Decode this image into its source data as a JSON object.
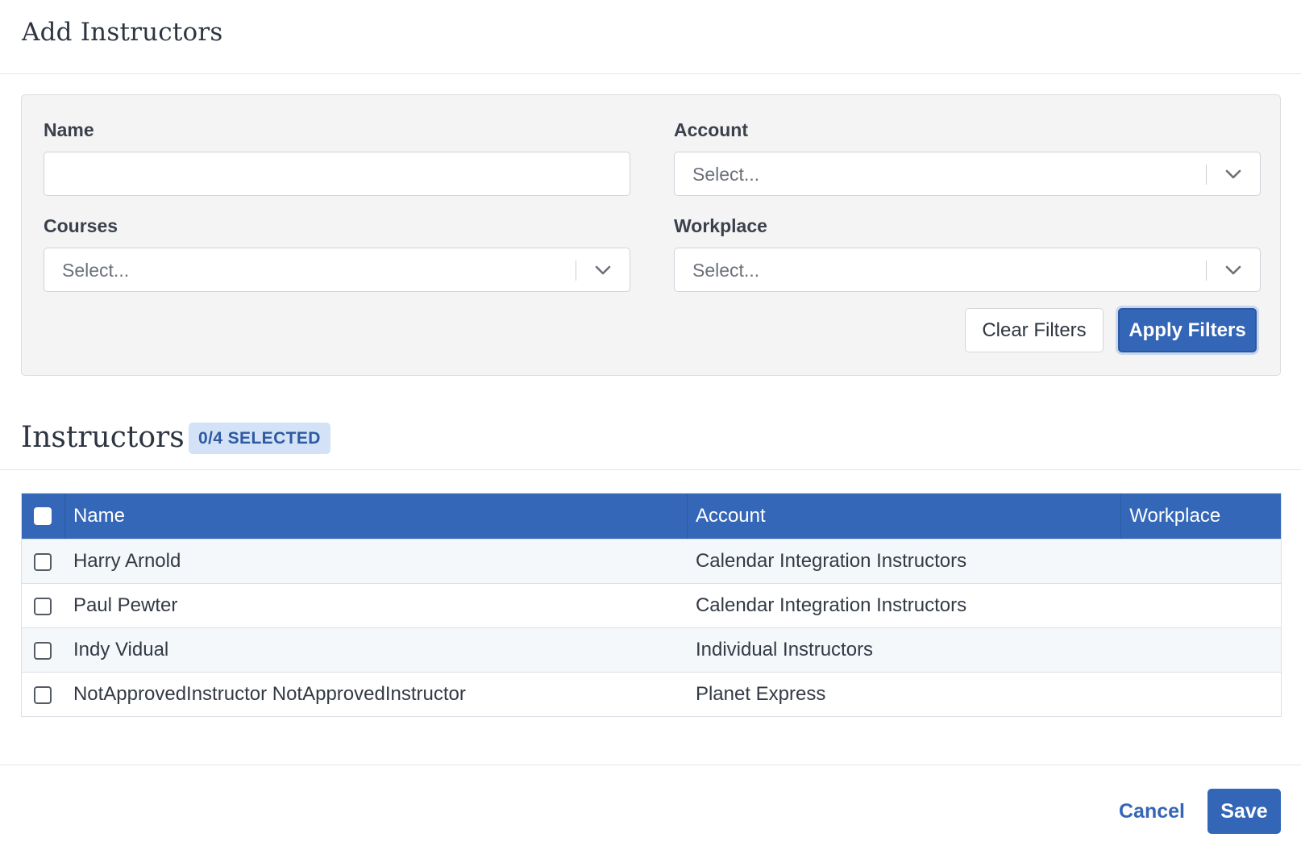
{
  "modal": {
    "title": "Add Instructors"
  },
  "filters": {
    "name": {
      "label": "Name",
      "value": "",
      "placeholder": ""
    },
    "account": {
      "label": "Account",
      "placeholder": "Select..."
    },
    "courses": {
      "label": "Courses",
      "placeholder": "Select..."
    },
    "workplace": {
      "label": "Workplace",
      "placeholder": "Select..."
    },
    "clear_label": "Clear Filters",
    "apply_label": "Apply Filters"
  },
  "instructors": {
    "title": "Instructors",
    "selected_badge": "0/4 SELECTED",
    "columns": [
      "Name",
      "Account",
      "Workplace"
    ],
    "rows": [
      {
        "name": "Harry Arnold",
        "account": "Calendar Integration Instructors",
        "workplace": "",
        "checked": false
      },
      {
        "name": "Paul Pewter",
        "account": "Calendar Integration Instructors",
        "workplace": "",
        "checked": false
      },
      {
        "name": "Indy Vidual",
        "account": "Individual Instructors",
        "workplace": "",
        "checked": false
      },
      {
        "name": "NotApprovedInstructor NotApprovedInstructor",
        "account": "Planet Express",
        "workplace": "",
        "checked": false
      }
    ]
  },
  "footer": {
    "cancel_label": "Cancel",
    "save_label": "Save"
  },
  "colors": {
    "primary": "#3466b7",
    "badge_bg": "#d3e2f7",
    "badge_text": "#2e5aa1",
    "panel_bg": "#f4f4f4"
  },
  "icons": {
    "select_indicator": "chevron-down-icon"
  }
}
